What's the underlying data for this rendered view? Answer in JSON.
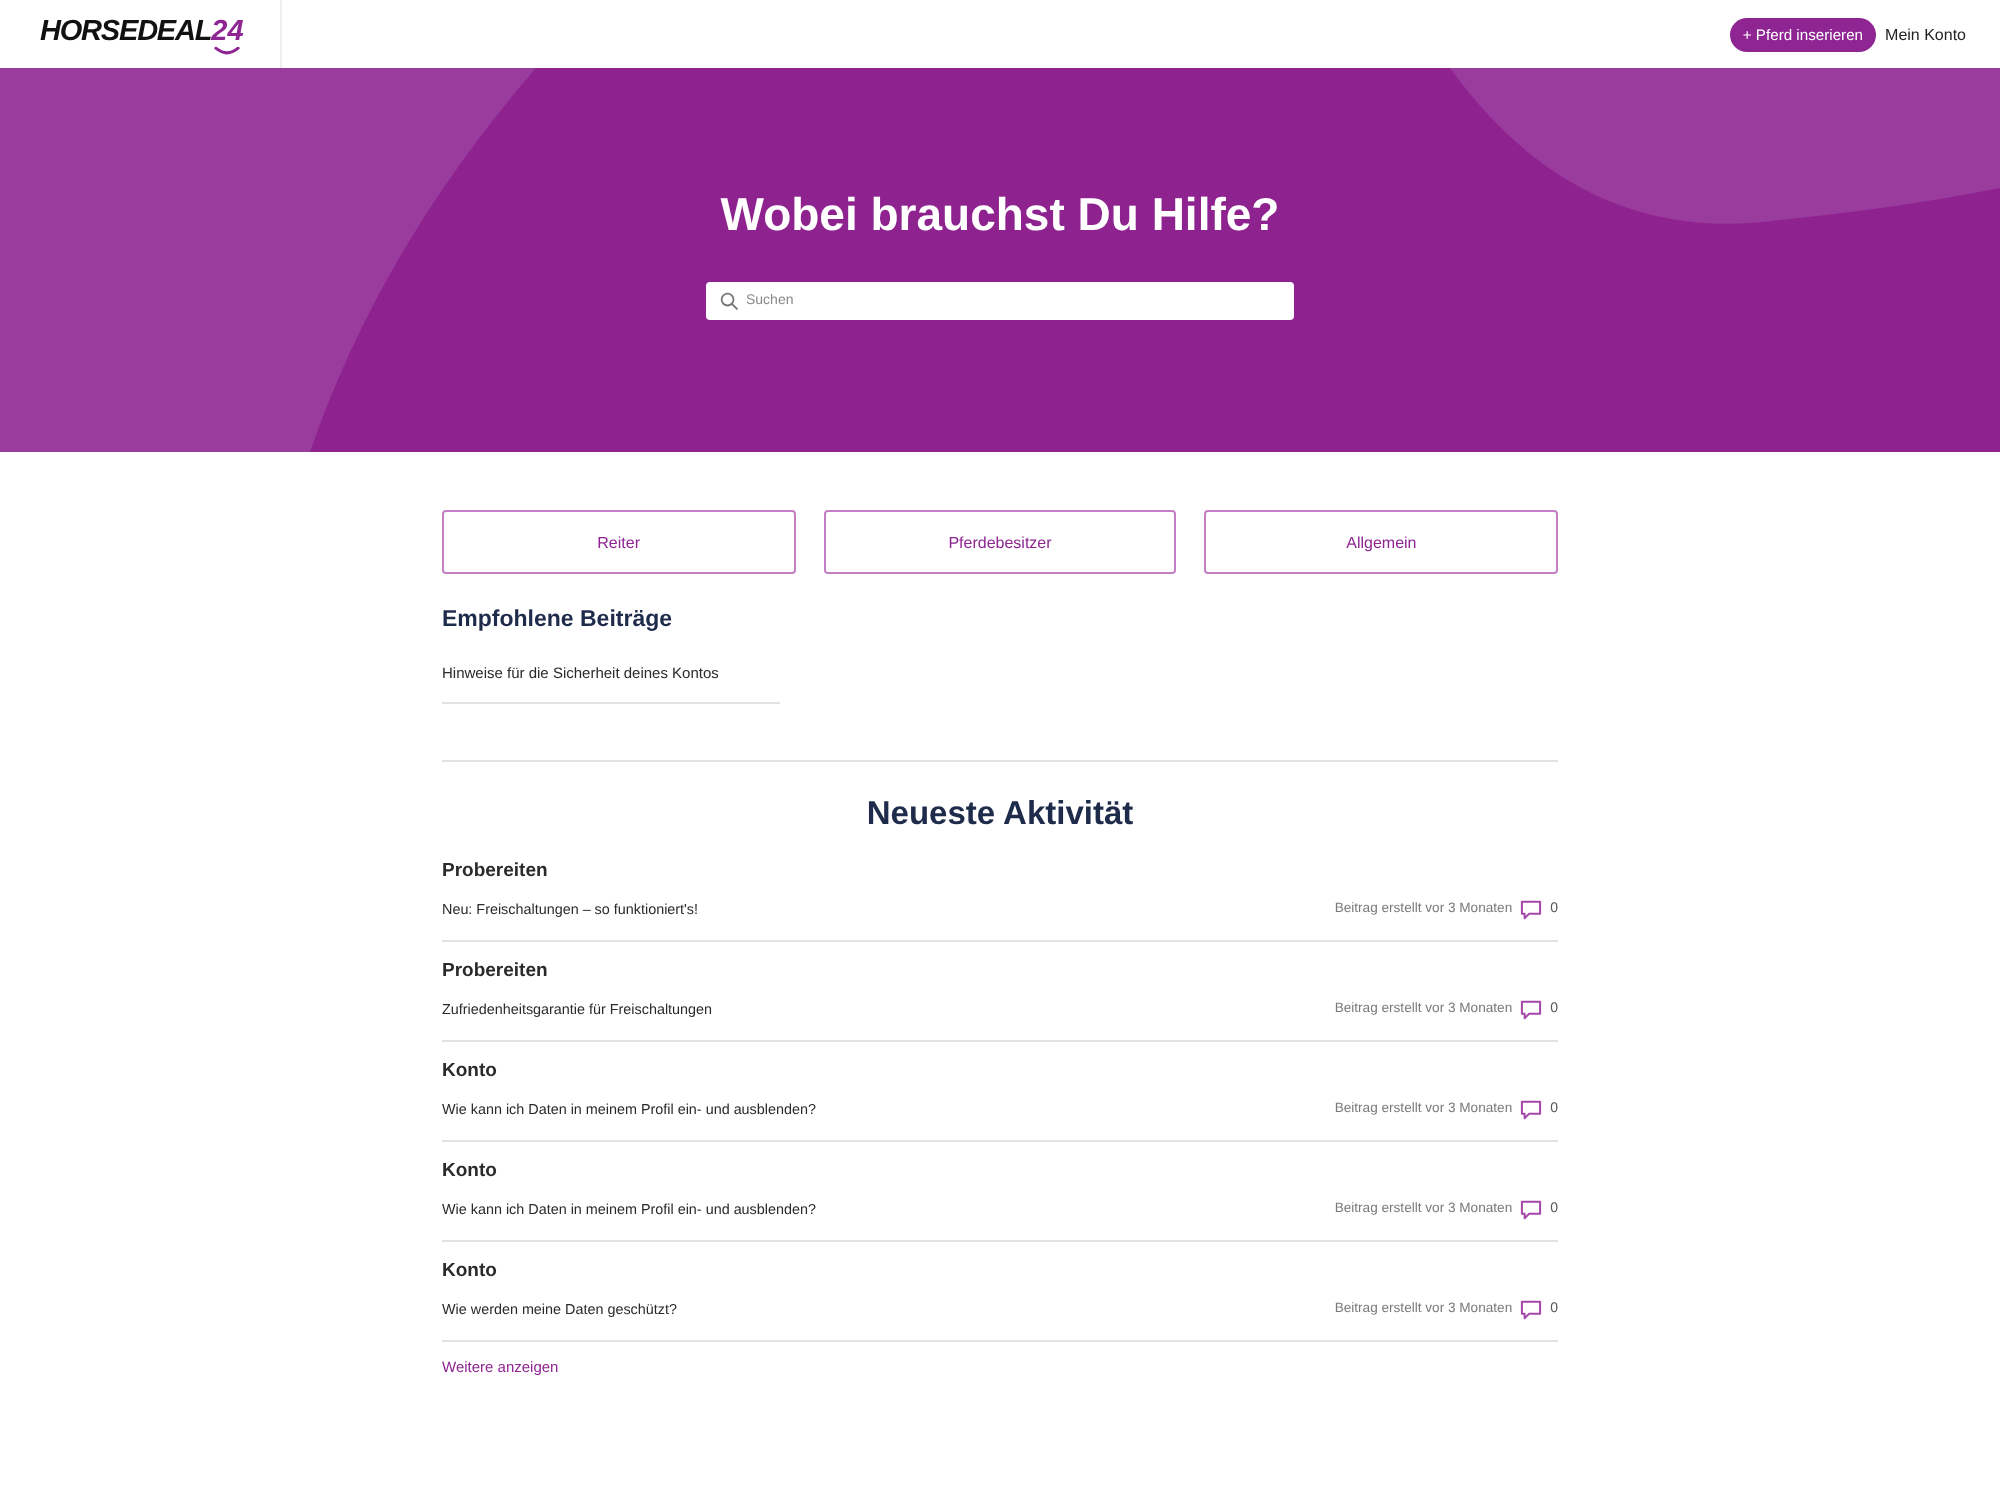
{
  "header": {
    "logo": {
      "name": "HORSEDEAL",
      "number": "24"
    },
    "cta_button": "+ Pferd inserieren",
    "account_link": "Mein Konto"
  },
  "hero": {
    "title": "Wobei brauchst Du Hilfe?",
    "search": {
      "placeholder": "Suchen"
    }
  },
  "categories": [
    "Reiter",
    "Pferdebesitzer",
    "Allgemein"
  ],
  "featured": {
    "heading": "Empfohlene Beiträge",
    "articles": [
      "Hinweise für die Sicherheit deines Kontos"
    ]
  },
  "activity": {
    "heading": "Neueste Aktivität",
    "posts": [
      {
        "category": "Probereiten",
        "title": "Neu: Freischaltungen – so funktioniert's!",
        "meta": "Beitrag erstellt vor 3 Monaten",
        "comments": "0"
      },
      {
        "category": "Probereiten",
        "title": "Zufriedenheitsgarantie für Freischaltungen",
        "meta": "Beitrag erstellt vor 3 Monaten",
        "comments": "0"
      },
      {
        "category": "Konto",
        "title": "Wie kann ich Daten in meinem Profil ein- und ausblenden?",
        "meta": "Beitrag erstellt vor 3 Monaten",
        "comments": "0"
      },
      {
        "category": "Konto",
        "title": "Wie kann ich Daten in meinem Profil ein- und ausblenden?",
        "meta": "Beitrag erstellt vor 3 Monaten",
        "comments": "0"
      },
      {
        "category": "Konto",
        "title": "Wie werden meine Daten geschützt?",
        "meta": "Beitrag erstellt vor 3 Monaten",
        "comments": "0"
      }
    ],
    "more_link": "Weitere anzeigen"
  }
}
